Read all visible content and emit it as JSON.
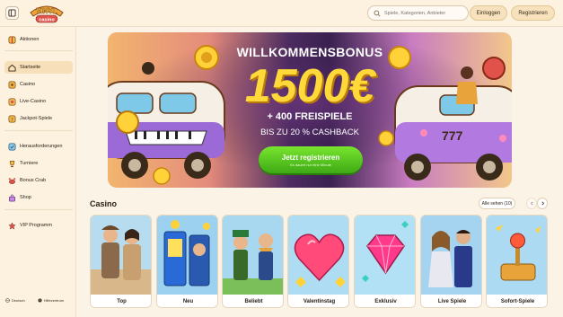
{
  "header": {
    "logo_text": "VINYL casino",
    "search_placeholder": "Spiele, Kategorien, Anbieter",
    "login_label": "Einloggen",
    "register_label": "Registrieren"
  },
  "sidebar": {
    "items": [
      {
        "label": "Aktionen",
        "icon": "gift-icon"
      },
      {
        "label": "Startseite",
        "icon": "home-icon"
      },
      {
        "label": "Casino",
        "icon": "casino-icon"
      },
      {
        "label": "Live-Casino",
        "icon": "live-icon"
      },
      {
        "label": "Jackpot-Spiele",
        "icon": "jackpot-icon"
      },
      {
        "label": "Herausforderungen",
        "icon": "challenge-icon"
      },
      {
        "label": "Turniere",
        "icon": "trophy-icon"
      },
      {
        "label": "Bonus Crab",
        "icon": "crab-icon"
      },
      {
        "label": "Shop",
        "icon": "shop-icon"
      },
      {
        "label": "VIP Programm",
        "icon": "vip-icon"
      }
    ],
    "footer": {
      "language": "Deutsch",
      "help": "Hilfezentrum"
    }
  },
  "banner": {
    "title": "WILLKOMMENSBONUS",
    "amount": "1500€",
    "line1": "+ 400 FREISPIELE",
    "line2": "BIS ZU 20 % CASHBACK",
    "cta_label": "Jetzt registrieren",
    "cta_note": "Es dauert nur eine Minute"
  },
  "casino": {
    "title": "Casino",
    "see_all": "Alle sehen (10)",
    "cards": [
      {
        "label": "Top"
      },
      {
        "label": "Neu"
      },
      {
        "label": "Beliebt"
      },
      {
        "label": "Valentinstag"
      },
      {
        "label": "Exklusiv"
      },
      {
        "label": "Live Spiele"
      },
      {
        "label": "Sofort-Spiele"
      }
    ]
  },
  "colors": {
    "accent_green": "#4fc21c",
    "gold": "#ffd83a",
    "background": "#fbf3e6"
  }
}
